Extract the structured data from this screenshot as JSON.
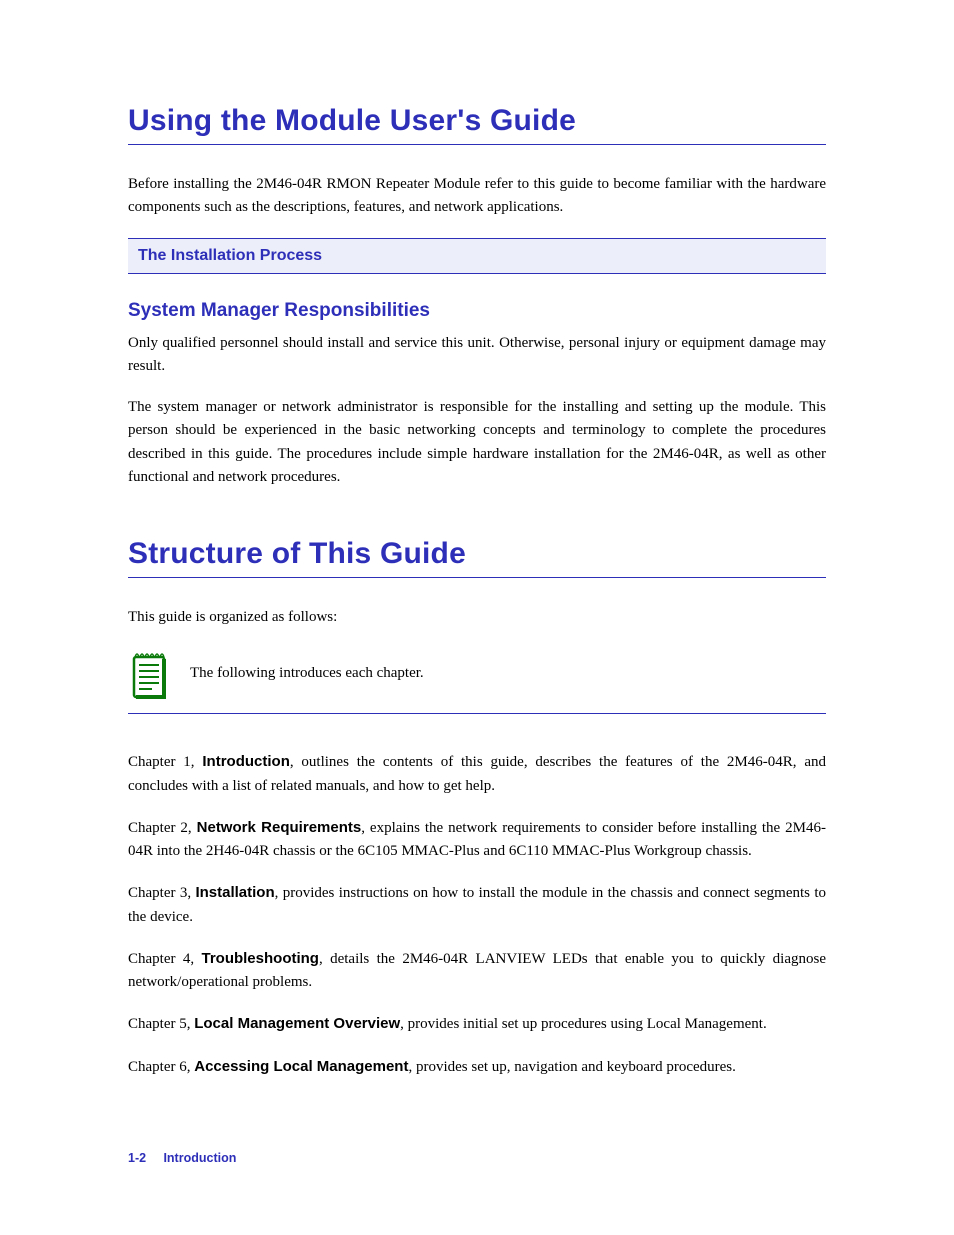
{
  "section1": {
    "heading": "Using the Module User's Guide",
    "para": "Before installing the 2M46-04R RMON Repeater Module refer to this guide to become familiar with the hardware components such as the descriptions, features, and network applications."
  },
  "callout": {
    "title": "The Installation Process"
  },
  "section2": {
    "h3": "System Manager Responsibilities",
    "para1": "Only qualified personnel should install and service this unit. Otherwise, personal injury or equipment damage may result.",
    "para2": "The system manager or network administrator is responsible for the installing and setting up the module. This person should be experienced in the basic networking concepts and terminology to complete the procedures described in this guide. The procedures include simple hardware installation for the 2M46-04R, as well as other functional and network procedures."
  },
  "section3": {
    "heading": "Structure of This Guide",
    "para_intro": "This guide is organized as follows:",
    "icon_para": "The following introduces each chapter.",
    "chapters": [
      {
        "prefix": "Chapter 1,",
        "title": "Introduction",
        "tail": ", outlines the contents of this guide, describes the features of the 2M46-04R, and concludes with a list of related manuals, and how to get help."
      },
      {
        "prefix": "Chapter 2,",
        "title": "Network Requirements",
        "tail": ", explains the network requirements to consider before installing the 2M46-04R into the 2H46-04R chassis or the 6C105 MMAC-Plus and 6C110 MMAC-Plus Workgroup chassis."
      },
      {
        "prefix": "Chapter 3,",
        "title": "Installation",
        "tail": ", provides instructions on how to install the module in the chassis and connect segments to the device."
      },
      {
        "prefix": "Chapter 4,",
        "title": "Troubleshooting",
        "tail": ", details the 2M46-04R LANVIEW LEDs that enable you to quickly diagnose network/operational problems."
      },
      {
        "prefix": "Chapter 5,",
        "title": "Local Management Overview",
        "tail": ", provides initial set up procedures using Local Management."
      },
      {
        "prefix": "Chapter 6,",
        "title": "Accessing Local Management",
        "tail": ", provides set up, navigation and keyboard procedures."
      }
    ]
  },
  "footer": {
    "pageno": "1-2",
    "chapter": "Introduction"
  }
}
